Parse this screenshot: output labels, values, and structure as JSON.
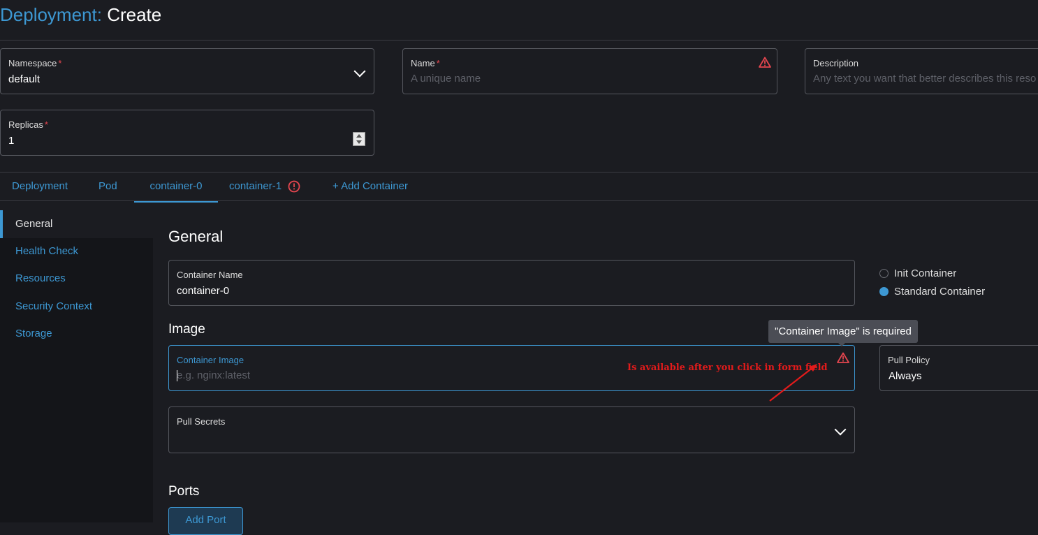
{
  "page": {
    "resource": "Deployment:",
    "action": "Create"
  },
  "fields": {
    "namespace": {
      "label": "Namespace",
      "required_mark": "*",
      "value": "default"
    },
    "name": {
      "label": "Name",
      "required_mark": "*",
      "placeholder": "A unique name"
    },
    "description": {
      "label": "Description",
      "placeholder": "Any text you want that better describes this reso"
    },
    "replicas": {
      "label": "Replicas",
      "required_mark": "*",
      "value": "1"
    }
  },
  "tabs": [
    {
      "label": "Deployment"
    },
    {
      "label": "Pod"
    },
    {
      "label": "container-0"
    },
    {
      "label": "container-1"
    },
    {
      "label": "+ Add Container"
    }
  ],
  "sidenav": [
    {
      "label": "General"
    },
    {
      "label": "Health Check"
    },
    {
      "label": "Resources"
    },
    {
      "label": "Security Context"
    },
    {
      "label": "Storage"
    }
  ],
  "general": {
    "heading": "General",
    "container_name": {
      "label": "Container Name",
      "value": "container-0"
    },
    "container_type": {
      "options": [
        "Init Container",
        "Standard Container"
      ],
      "selected": "Standard Container"
    }
  },
  "image": {
    "heading": "Image",
    "container_image": {
      "label": "Container Image",
      "placeholder": "e.g. nginx:latest"
    },
    "tooltip": "\"Container Image\" is required",
    "annotation": "Is available after you click in form field",
    "pull_policy": {
      "label": "Pull Policy",
      "value": "Always"
    },
    "pull_secrets": {
      "label": "Pull Secrets"
    }
  },
  "ports": {
    "heading": "Ports",
    "add_button": "Add Port"
  },
  "colors": {
    "accent": "#3d98d3",
    "error": "#e5464f",
    "annotation": "#e31b1b",
    "background": "#1b1c21"
  }
}
